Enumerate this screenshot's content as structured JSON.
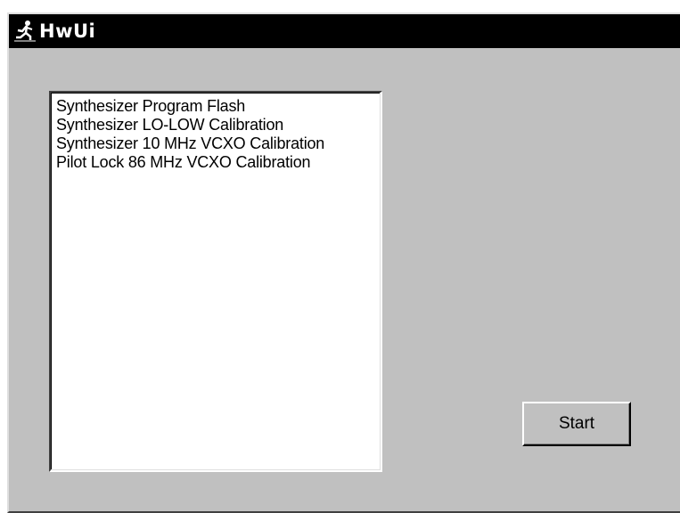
{
  "window": {
    "title": "HwUi",
    "app_icon": "running-figure-icon"
  },
  "list": {
    "items": [
      {
        "label": "Synthesizer Program Flash"
      },
      {
        "label": "Synthesizer LO-LOW Calibration"
      },
      {
        "label": "Synthesizer 10 MHz VCXO Calibration"
      },
      {
        "label": "Pilot Lock 86 MHz VCXO Calibration"
      }
    ]
  },
  "actions": {
    "start_label": "Start"
  },
  "colors": {
    "titlebar": "#000000",
    "face": "#c0c0c0",
    "list_bg": "#ffffff"
  }
}
